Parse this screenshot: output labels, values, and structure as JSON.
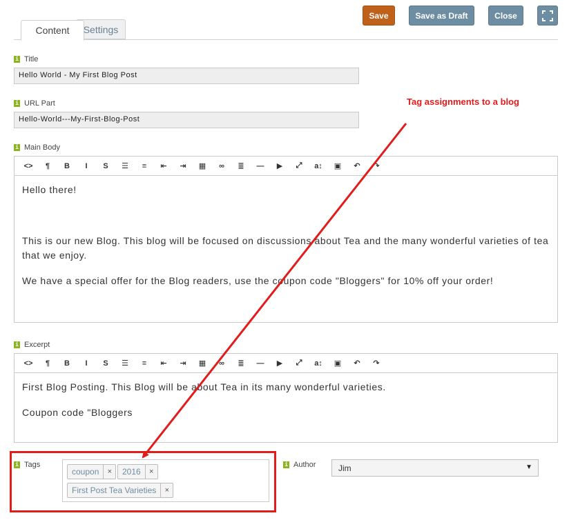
{
  "toolbar": {
    "save_label": "Save",
    "draft_label": "Save as Draft",
    "close_label": "Close",
    "fullscreen_icon": "fullscreen-icon"
  },
  "tabs": [
    {
      "label": "Content"
    },
    {
      "label": "Settings"
    }
  ],
  "fields": {
    "title": {
      "label": "Title",
      "value": "Hello World  - My First Blog Post"
    },
    "url_part": {
      "label": "URL Part",
      "value": "Hello-World---My-First-Blog-Post"
    }
  },
  "main_body": {
    "label": "Main Body",
    "paragraphs": [
      "Hello there!",
      "This is our new Blog. This blog will be focused on discussions about Tea and the many wonderful varieties of tea that we enjoy.",
      "We have a special offer for the Blog readers, use the coupon code \"Bloggers\" for 10% off your order!"
    ]
  },
  "excerpt": {
    "label": "Excerpt",
    "paragraphs": [
      "First Blog Posting. This Blog will be about Tea in its many wonderful varieties.",
      "Coupon code \"Bloggers"
    ]
  },
  "editor_tools": [
    {
      "glyph": "<>",
      "icon": "code-view-icon"
    },
    {
      "glyph": "¶",
      "icon": "paragraph-icon"
    },
    {
      "glyph": "B",
      "icon": "bold-icon"
    },
    {
      "glyph": "I",
      "icon": "italic-icon"
    },
    {
      "glyph": "S",
      "icon": "strikethrough-icon"
    },
    {
      "glyph": "☰",
      "icon": "unordered-list-icon"
    },
    {
      "glyph": "≡",
      "icon": "ordered-list-icon"
    },
    {
      "glyph": "⇤",
      "icon": "outdent-icon"
    },
    {
      "glyph": "⇥",
      "icon": "indent-icon"
    },
    {
      "glyph": "▦",
      "icon": "table-icon"
    },
    {
      "glyph": "∞",
      "icon": "link-icon"
    },
    {
      "glyph": "≣",
      "icon": "align-icon"
    },
    {
      "glyph": "—",
      "icon": "horizontal-rule-icon"
    },
    {
      "glyph": "▶",
      "icon": "video-icon"
    },
    {
      "glyph": "⤢",
      "icon": "fullscreen-icon"
    },
    {
      "glyph": "a↕",
      "icon": "font-size-icon"
    },
    {
      "glyph": "▣",
      "icon": "image-icon"
    },
    {
      "glyph": "↶",
      "icon": "undo-icon"
    },
    {
      "glyph": "↷",
      "icon": "redo-icon"
    }
  ],
  "tags": {
    "label": "Tags",
    "items": [
      {
        "label": "coupon"
      },
      {
        "label": "2016"
      },
      {
        "label": "First Post Tea Varieties"
      }
    ],
    "remove_glyph": "×"
  },
  "author": {
    "label": "Author",
    "value": "Jim"
  },
  "annotation": {
    "text": "Tag assignments to a blog",
    "color": "#e8191a"
  },
  "colors": {
    "save": "#c0611b",
    "secondary": "#6d8da3",
    "info_icon": "#8bb51f"
  }
}
